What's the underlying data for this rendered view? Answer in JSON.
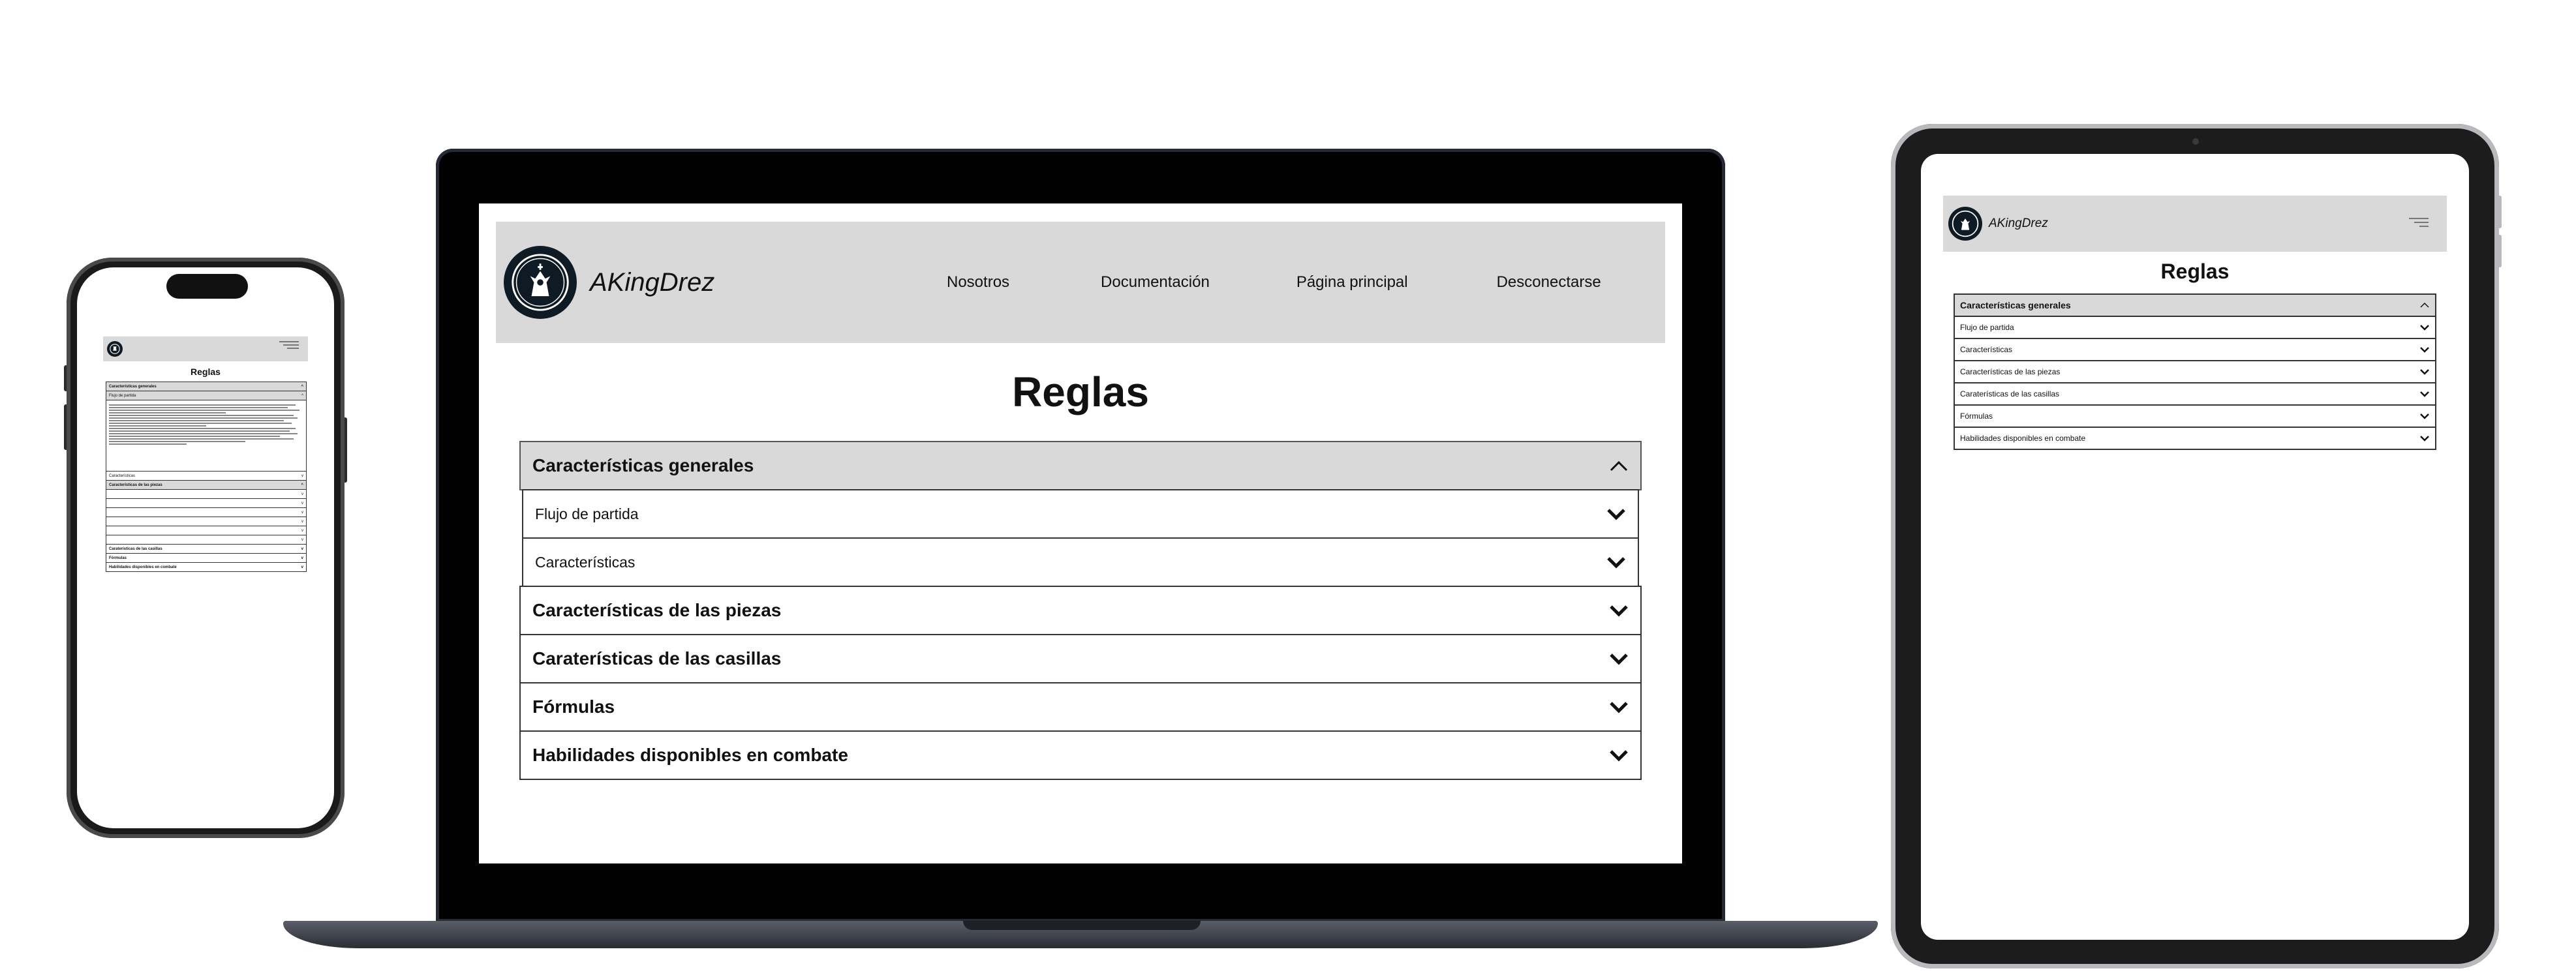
{
  "site": {
    "brand": "AKingDrez",
    "nav": [
      "Nosotros",
      "Documentación",
      "Página principal",
      "Desconectarse"
    ],
    "title": "Reglas"
  },
  "accordion": {
    "general": "Características generales",
    "sub": [
      "Flujo de partida",
      "Características"
    ],
    "sections": [
      "Características de las piezas",
      "Caraterísticas de las casillas",
      "Fórmulas",
      "Habilidades disponibles en combate"
    ]
  },
  "phone_items": {
    "piece_subitems": [
      "",
      "",
      "",
      "",
      "",
      ""
    ],
    "cells": "Caraterísticas de las casillas"
  },
  "colors": {
    "nav_bg": "#d9d9d9",
    "logo_bg": "#0f1b24",
    "laptop_bezel": "#000000",
    "border": "#333333"
  },
  "icons": {
    "open": "chevron-up-icon",
    "closed": "chevron-down-icon",
    "menu": "hamburger-icon",
    "logo": "king-emblem-icon"
  }
}
